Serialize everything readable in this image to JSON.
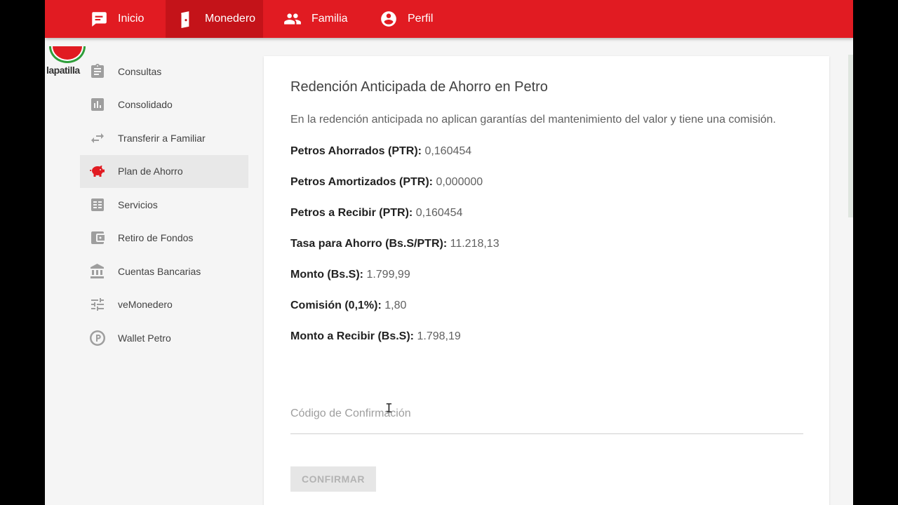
{
  "nav": {
    "items": [
      {
        "label": "Inicio",
        "icon": "chat-icon"
      },
      {
        "label": "Monedero",
        "icon": "wallet-icon"
      },
      {
        "label": "Familia",
        "icon": "people-icon"
      },
      {
        "label": "Perfil",
        "icon": "account-icon"
      }
    ],
    "active": "Monedero"
  },
  "logo": {
    "text": "lapatilla"
  },
  "sidebar": {
    "items": [
      {
        "label": "Consultas",
        "icon": "clipboard-icon"
      },
      {
        "label": "Consolidado",
        "icon": "bar-chart-icon"
      },
      {
        "label": "Transferir a Familiar",
        "icon": "transfer-icon"
      },
      {
        "label": "Plan de Ahorro",
        "icon": "piggy-bank-icon"
      },
      {
        "label": "Servicios",
        "icon": "list-icon"
      },
      {
        "label": "Retiro de Fondos",
        "icon": "wallet-icon"
      },
      {
        "label": "Cuentas Bancarias",
        "icon": "bank-icon"
      },
      {
        "label": "veMonedero",
        "icon": "tune-icon"
      },
      {
        "label": "Wallet Petro",
        "icon": "petro-coin-icon"
      }
    ],
    "active": "Plan de Ahorro"
  },
  "card": {
    "title": "Redención Anticipada de Ahorro en Petro",
    "description": "En la redención anticipada no aplican garantías del mantenimiento del valor y tiene una comisión.",
    "rows": [
      {
        "label": "Petros Ahorrados (PTR):",
        "value": "0,160454"
      },
      {
        "label": "Petros Amortizados (PTR):",
        "value": "0,000000"
      },
      {
        "label": "Petros a Recibir (PTR):",
        "value": "0,160454"
      },
      {
        "label": "Tasa para Ahorro (Bs.S/PTR):",
        "value": "11.218,13"
      },
      {
        "label": "Monto (Bs.S):",
        "value": "1.799,99"
      },
      {
        "label": "Comisión (0,1%):",
        "value": "1,80"
      },
      {
        "label": "Monto a Recibir (Bs.S):",
        "value": "1.798,19"
      }
    ],
    "code_placeholder": "Código de Confirmación",
    "confirm_label": "CONFIRMAR"
  },
  "colors": {
    "brand": "#e11b22",
    "active_nav": "#c41319"
  }
}
